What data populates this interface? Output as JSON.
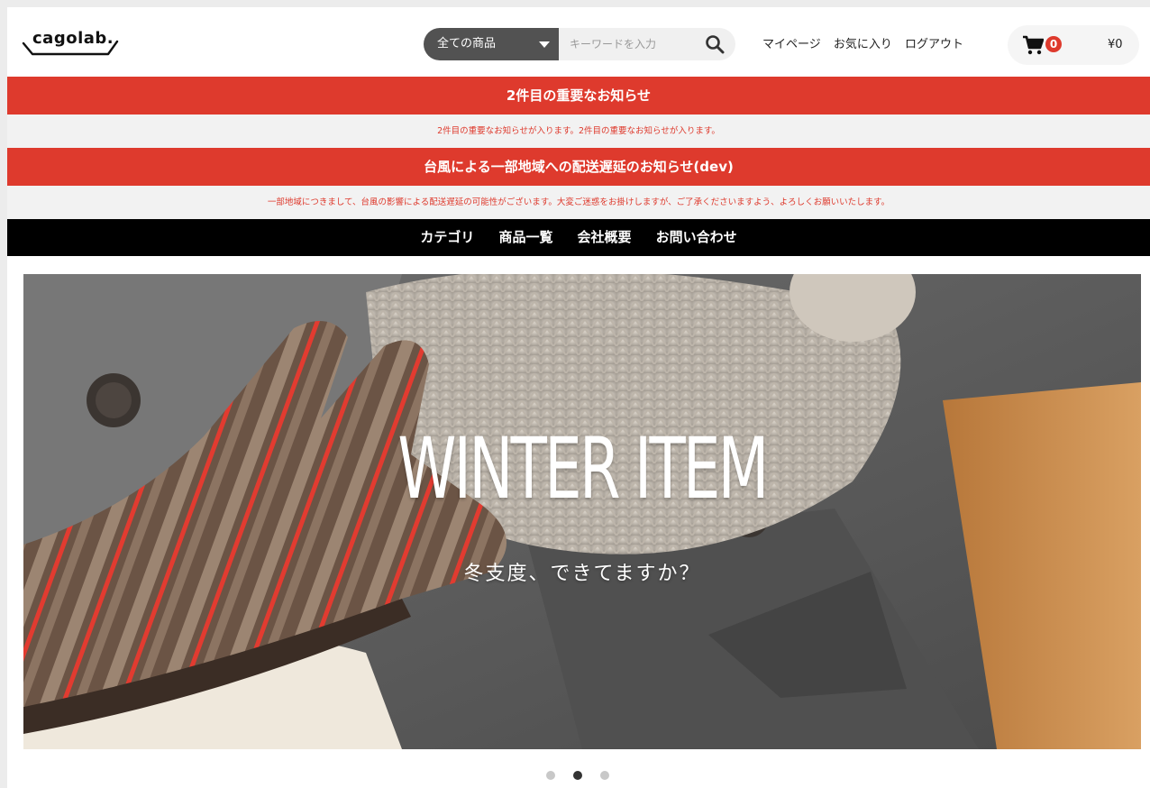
{
  "header": {
    "logo_text": "cagolab.",
    "search": {
      "category_selected": "全ての商品",
      "placeholder": "キーワードを入力"
    },
    "links": [
      "マイページ",
      "お気に入り",
      "ログアウト"
    ],
    "cart": {
      "count": "0",
      "total": "¥0"
    }
  },
  "notices": [
    {
      "title": "2件目の重要なお知らせ",
      "body": "2件目の重要なお知らせが入ります。2件目の重要なお知らせが入ります。"
    },
    {
      "title": "台風による一部地域への配送遅延のお知らせ(dev)",
      "body": "一部地域につきまして、台風の影響による配送遅延の可能性がございます。大変ご迷惑をお掛けしますが、ご了承くださいますよう、よろしくお願いいたします。"
    }
  ],
  "main_nav": [
    "カテゴリ",
    "商品一覧",
    "会社概要",
    "お問い合わせ"
  ],
  "hero": {
    "title": "WINTER ITEM",
    "subtitle": "冬支度、できてますか？"
  },
  "slider": {
    "total": 3,
    "active_index": 1
  },
  "colors": {
    "accent_red": "#de3a2d",
    "nav_black": "#000000",
    "select_gray": "#525252"
  },
  "icons": {
    "search": "search-icon",
    "cart": "cart-icon",
    "caret": "chevron-down-icon"
  }
}
